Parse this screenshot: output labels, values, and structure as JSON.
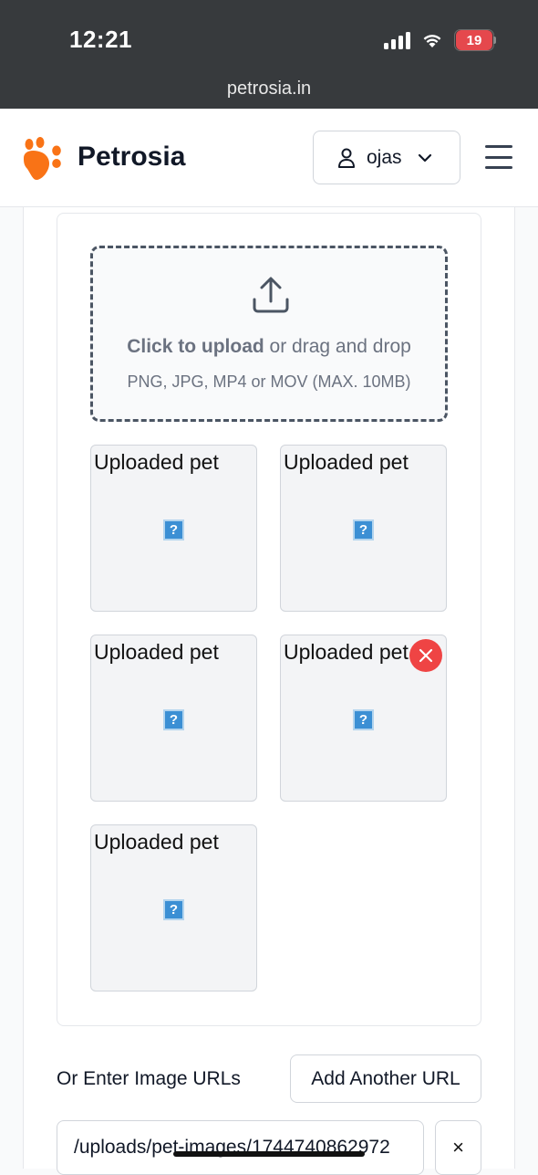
{
  "status_bar": {
    "time": "12:21",
    "battery": "19",
    "url": "petrosia.in"
  },
  "navbar": {
    "brand": "Petrosia",
    "user_name": "ojas",
    "logo_color": "#f97316"
  },
  "dropzone": {
    "action_text": "Click to upload",
    "rest_text": " or drag and drop",
    "formats": "PNG, JPG, MP4 or MOV (MAX. 10MB)"
  },
  "thumbnails": [
    {
      "alt": "Uploaded pet"
    },
    {
      "alt": "Uploaded pet"
    },
    {
      "alt": "Uploaded pet"
    },
    {
      "alt": "Uploaded pet"
    },
    {
      "alt": "Uploaded pet"
    }
  ],
  "url_section": {
    "heading": "Or Enter Image URLs",
    "add_button": "Add Another URL",
    "url_value": "/uploads/pet-images/1744740862972",
    "remove_label": "×"
  }
}
